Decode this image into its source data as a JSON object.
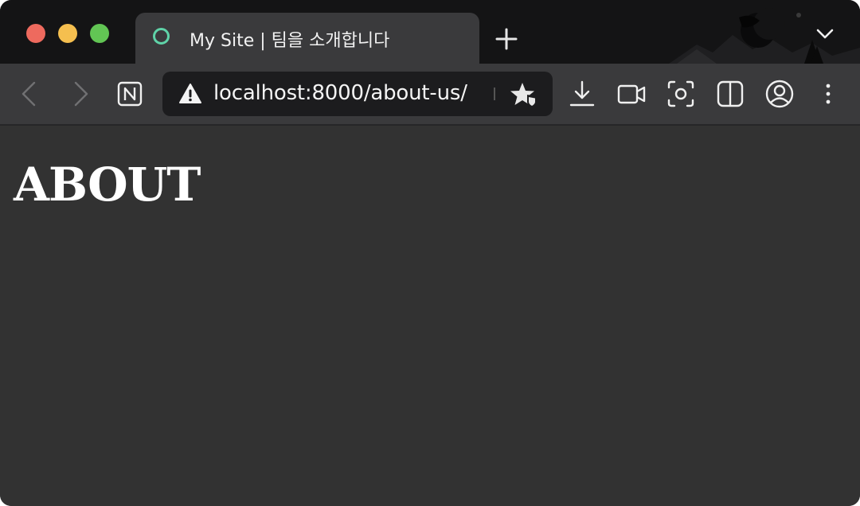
{
  "browser": {
    "tab": {
      "title": "My Site | 팀을 소개합니다"
    },
    "url": "localhost:8000/about-us/",
    "window_controls": [
      "close",
      "minimize",
      "zoom"
    ],
    "toolbar_icons": [
      "back-arrow-icon",
      "forward-arrow-icon",
      "notion-n-icon",
      "download-icon",
      "video-camera-icon",
      "screenshot-icon",
      "split-view-icon",
      "profile-icon",
      "more-vertical-icon"
    ],
    "colors": {
      "tabstrip_bg": "#141415",
      "toolbar_bg": "#3a3a3c",
      "content_bg": "#323232",
      "favicon_ring": "#5fd3a8"
    }
  },
  "page": {
    "heading": "ABOUT"
  }
}
